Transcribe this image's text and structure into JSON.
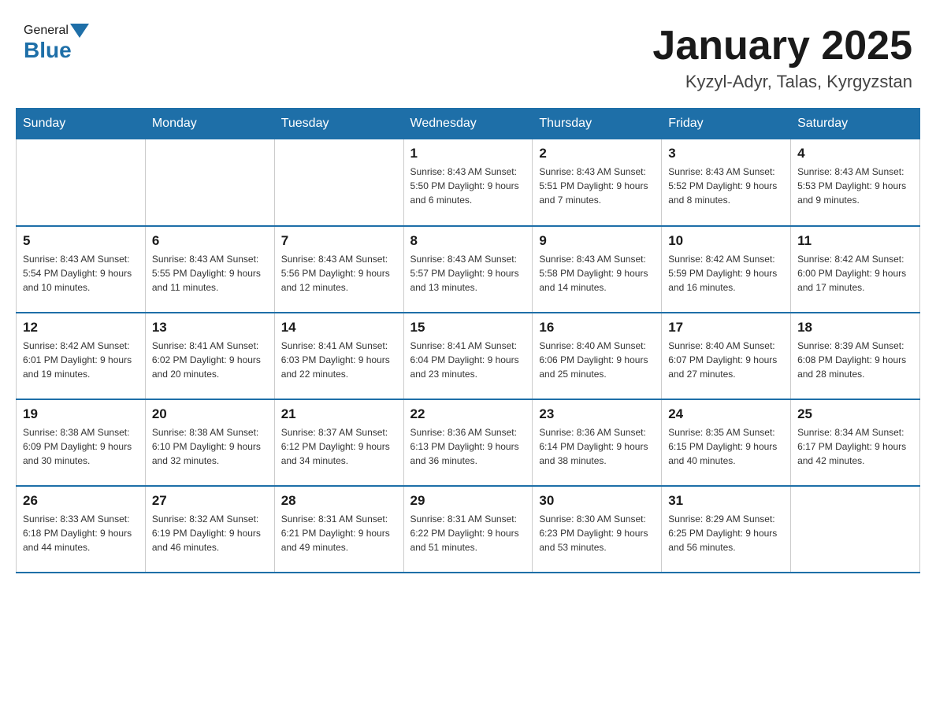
{
  "header": {
    "logo_general": "General",
    "logo_blue": "Blue",
    "title": "January 2025",
    "location": "Kyzyl-Adyr, Talas, Kyrgyzstan"
  },
  "days_of_week": [
    "Sunday",
    "Monday",
    "Tuesday",
    "Wednesday",
    "Thursday",
    "Friday",
    "Saturday"
  ],
  "weeks": [
    [
      {
        "day": "",
        "info": ""
      },
      {
        "day": "",
        "info": ""
      },
      {
        "day": "",
        "info": ""
      },
      {
        "day": "1",
        "info": "Sunrise: 8:43 AM\nSunset: 5:50 PM\nDaylight: 9 hours and 6 minutes."
      },
      {
        "day": "2",
        "info": "Sunrise: 8:43 AM\nSunset: 5:51 PM\nDaylight: 9 hours and 7 minutes."
      },
      {
        "day": "3",
        "info": "Sunrise: 8:43 AM\nSunset: 5:52 PM\nDaylight: 9 hours and 8 minutes."
      },
      {
        "day": "4",
        "info": "Sunrise: 8:43 AM\nSunset: 5:53 PM\nDaylight: 9 hours and 9 minutes."
      }
    ],
    [
      {
        "day": "5",
        "info": "Sunrise: 8:43 AM\nSunset: 5:54 PM\nDaylight: 9 hours and 10 minutes."
      },
      {
        "day": "6",
        "info": "Sunrise: 8:43 AM\nSunset: 5:55 PM\nDaylight: 9 hours and 11 minutes."
      },
      {
        "day": "7",
        "info": "Sunrise: 8:43 AM\nSunset: 5:56 PM\nDaylight: 9 hours and 12 minutes."
      },
      {
        "day": "8",
        "info": "Sunrise: 8:43 AM\nSunset: 5:57 PM\nDaylight: 9 hours and 13 minutes."
      },
      {
        "day": "9",
        "info": "Sunrise: 8:43 AM\nSunset: 5:58 PM\nDaylight: 9 hours and 14 minutes."
      },
      {
        "day": "10",
        "info": "Sunrise: 8:42 AM\nSunset: 5:59 PM\nDaylight: 9 hours and 16 minutes."
      },
      {
        "day": "11",
        "info": "Sunrise: 8:42 AM\nSunset: 6:00 PM\nDaylight: 9 hours and 17 minutes."
      }
    ],
    [
      {
        "day": "12",
        "info": "Sunrise: 8:42 AM\nSunset: 6:01 PM\nDaylight: 9 hours and 19 minutes."
      },
      {
        "day": "13",
        "info": "Sunrise: 8:41 AM\nSunset: 6:02 PM\nDaylight: 9 hours and 20 minutes."
      },
      {
        "day": "14",
        "info": "Sunrise: 8:41 AM\nSunset: 6:03 PM\nDaylight: 9 hours and 22 minutes."
      },
      {
        "day": "15",
        "info": "Sunrise: 8:41 AM\nSunset: 6:04 PM\nDaylight: 9 hours and 23 minutes."
      },
      {
        "day": "16",
        "info": "Sunrise: 8:40 AM\nSunset: 6:06 PM\nDaylight: 9 hours and 25 minutes."
      },
      {
        "day": "17",
        "info": "Sunrise: 8:40 AM\nSunset: 6:07 PM\nDaylight: 9 hours and 27 minutes."
      },
      {
        "day": "18",
        "info": "Sunrise: 8:39 AM\nSunset: 6:08 PM\nDaylight: 9 hours and 28 minutes."
      }
    ],
    [
      {
        "day": "19",
        "info": "Sunrise: 8:38 AM\nSunset: 6:09 PM\nDaylight: 9 hours and 30 minutes."
      },
      {
        "day": "20",
        "info": "Sunrise: 8:38 AM\nSunset: 6:10 PM\nDaylight: 9 hours and 32 minutes."
      },
      {
        "day": "21",
        "info": "Sunrise: 8:37 AM\nSunset: 6:12 PM\nDaylight: 9 hours and 34 minutes."
      },
      {
        "day": "22",
        "info": "Sunrise: 8:36 AM\nSunset: 6:13 PM\nDaylight: 9 hours and 36 minutes."
      },
      {
        "day": "23",
        "info": "Sunrise: 8:36 AM\nSunset: 6:14 PM\nDaylight: 9 hours and 38 minutes."
      },
      {
        "day": "24",
        "info": "Sunrise: 8:35 AM\nSunset: 6:15 PM\nDaylight: 9 hours and 40 minutes."
      },
      {
        "day": "25",
        "info": "Sunrise: 8:34 AM\nSunset: 6:17 PM\nDaylight: 9 hours and 42 minutes."
      }
    ],
    [
      {
        "day": "26",
        "info": "Sunrise: 8:33 AM\nSunset: 6:18 PM\nDaylight: 9 hours and 44 minutes."
      },
      {
        "day": "27",
        "info": "Sunrise: 8:32 AM\nSunset: 6:19 PM\nDaylight: 9 hours and 46 minutes."
      },
      {
        "day": "28",
        "info": "Sunrise: 8:31 AM\nSunset: 6:21 PM\nDaylight: 9 hours and 49 minutes."
      },
      {
        "day": "29",
        "info": "Sunrise: 8:31 AM\nSunset: 6:22 PM\nDaylight: 9 hours and 51 minutes."
      },
      {
        "day": "30",
        "info": "Sunrise: 8:30 AM\nSunset: 6:23 PM\nDaylight: 9 hours and 53 minutes."
      },
      {
        "day": "31",
        "info": "Sunrise: 8:29 AM\nSunset: 6:25 PM\nDaylight: 9 hours and 56 minutes."
      },
      {
        "day": "",
        "info": ""
      }
    ]
  ]
}
